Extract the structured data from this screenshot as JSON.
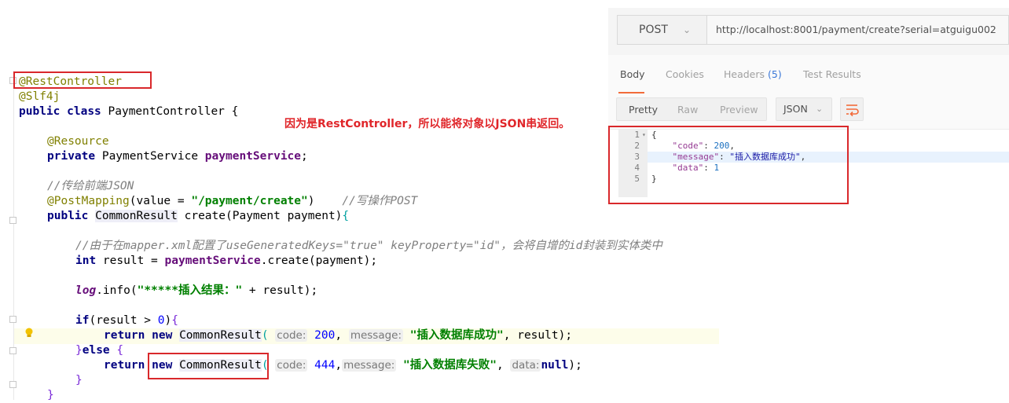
{
  "ide": {
    "annotation_explain": "因为是RestController，所以能将对象以JSON串返回。",
    "lines": {
      "l1": "@RestController",
      "l2": "@Slf4j",
      "l3_kw1": "public",
      "l3_kw2": "class",
      "l3_rest": " PaymentController {",
      "l5_ann": "@Resource",
      "l6_kw": "private",
      "l6_type": " PaymentService ",
      "l6_field": "paymentService",
      "l6_end": ";",
      "l8_cmt": "//传给前端JSON",
      "l9_ann": "@PostMapping",
      "l9_a": "(value = ",
      "l9_str": "\"/payment/create\"",
      "l9_b": ")",
      "l9_cmt": "//写操作POST",
      "l10_kw": "public",
      "l10_type": "CommonResult",
      "l10_rest": " create(Payment payment)",
      "l10_brace": "{",
      "l12_cmt": "//由于在mapper.xml配置了useGeneratedKeys=\"true\" keyProperty=\"id\"，会将自增的id封装到实体类中",
      "l13_kw": "int",
      "l13_a": " result = ",
      "l13_field": "paymentService",
      "l13_b": ".create(payment);",
      "l15_log": "log",
      "l15_a": ".info(",
      "l15_str": "\"*****插入结果：\"",
      "l15_b": " + result);",
      "l17_kw": "if",
      "l17_a": "(result > ",
      "l17_num": "0",
      "l17_b": ")",
      "l17_brace": "{",
      "l18_kw1": "return",
      "l18_kw2": "new",
      "l18_type": "CommonResult",
      "l18_paren": "(",
      "l18_hint1": "code:",
      "l18_num": "200",
      "l18_comma": ", ",
      "l18_hint2": "message:",
      "l18_str": "\"插入数据库成功\"",
      "l18_end": ", result);",
      "l19_brace1": "}",
      "l19_kw": "else",
      "l19_brace2": "{",
      "l20_kw1": "return",
      "l20_kw2": "new",
      "l20_type": "CommonResult",
      "l20_paren": "(",
      "l20_hint1": "code:",
      "l20_num": "444",
      "l20_comma": ",",
      "l20_hint2": "message:",
      "l20_str": "\"插入数据库失败\"",
      "l20_comma2": ", ",
      "l20_hint3": "data:",
      "l20_null": "null",
      "l20_end": ");",
      "l21_brace": "}",
      "l22_brace": "}"
    }
  },
  "postman": {
    "method": "POST",
    "url": "http://localhost:8001/payment/create?serial=atguigu002",
    "tabs": {
      "body": "Body",
      "cookies": "Cookies",
      "headers": "Headers",
      "headers_count": "(5)",
      "tests": "Test Results"
    },
    "formats": {
      "pretty": "Pretty",
      "raw": "Raw",
      "preview": "Preview",
      "type": "JSON"
    },
    "response": {
      "line_numbers": [
        "1",
        "2",
        "3",
        "4",
        "5"
      ],
      "open": "{",
      "code_key": "\"code\"",
      "code_val": "200",
      "msg_key": "\"message\"",
      "msg_val": "\"插入数据库成功\"",
      "data_key": "\"data\"",
      "data_val": "1",
      "close": "}"
    }
  },
  "colors": {
    "highlight_box": "#d9282b",
    "keyword": "#000080",
    "string": "#008000",
    "accent_tab": "#f26b3a"
  }
}
